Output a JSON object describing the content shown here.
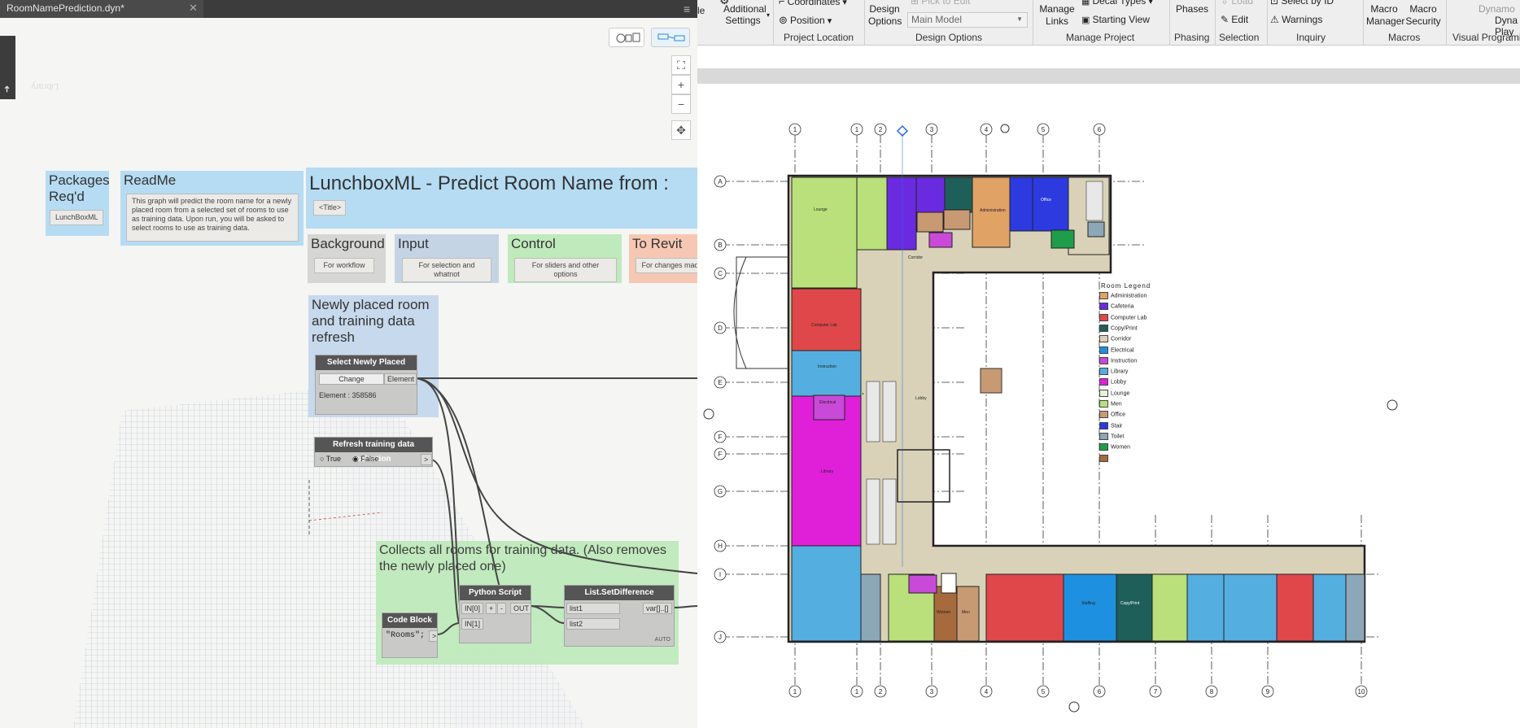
{
  "dynamo": {
    "tab_title": "RoomNamePrediction.dyn*",
    "library_label": "Library",
    "groups": {
      "packages": {
        "title": "Packages Req'd",
        "note": "LunchBoxML"
      },
      "readme": {
        "title": "ReadMe",
        "note": "This graph will predict the room name for a newly placed room from a selected set of rooms to use as training data. Upon run, you will be asked to select rooms to use as training data."
      },
      "main_title": {
        "title": "LunchboxML - Predict Room Name from :",
        "note": "<Title>"
      },
      "background": {
        "title": "Background",
        "note": "For workflow"
      },
      "input": {
        "title": "Input",
        "note": "For selection and whatnot"
      },
      "control": {
        "title": "Control",
        "note": "For sliders and other options"
      },
      "to_revit": {
        "title": "To Revit",
        "note": "For changes made"
      },
      "newly_placed": {
        "title": "Newly placed room and training data refresh"
      },
      "collects": {
        "title": "Collects all rooms for training data. (Also removes the newly placed one)"
      }
    },
    "nodes": {
      "select_room": {
        "title": "Select Newly Placed Room",
        "change": "Change",
        "out": "Element",
        "value": "Element : 358586"
      },
      "refresh": {
        "title": "Refresh training data selection",
        "true_label": "True",
        "false_label": "False",
        "out": ">"
      },
      "python": {
        "title": "Python Script",
        "in0": "IN[0]",
        "in1": "IN[1]",
        "plus": "+",
        "minus": "-",
        "out": "OUT"
      },
      "code_block": {
        "title": "Code Block",
        "code": "\"Rooms\";",
        "out": ">"
      },
      "setdiff": {
        "title": "List.SetDifference",
        "list1": "list1",
        "list2": "list2",
        "out": "var[]..[]",
        "auto": "AUTO"
      }
    }
  },
  "revit": {
    "ribbon": {
      "cut_label": "le",
      "additional_settings": "Additional Settings",
      "coordinates": "Coordinates",
      "position": "Position",
      "design_options_btn": "Design Options",
      "pick_to_edit": "Pick to Edit",
      "main_model": "Main Model",
      "manage_links": "Manage Links",
      "decal_types": "Decal Types",
      "starting_view": "Starting View",
      "phases": "Phases",
      "load": "Load",
      "edit": "Edit",
      "select_by_id": "Select  by ID",
      "warnings": "Warnings",
      "macro_manager": "Macro Manager",
      "macro_security": "Macro Security",
      "dynamo": "Dynamo",
      "dyna_player": "Dyna Play",
      "panels": {
        "project_location": "Project Location",
        "design_options": "Design Options",
        "manage_project": "Manage Project",
        "phasing": "Phasing",
        "selection": "Selection",
        "inquiry": "Inquiry",
        "macros": "Macros",
        "visual_programming": "Visual Programi"
      }
    },
    "grid_top": [
      "1",
      "1",
      "2",
      "3",
      "4",
      "5",
      "6"
    ],
    "grid_bottom": [
      "1",
      "1",
      "2",
      "3",
      "4",
      "5",
      "6",
      "7",
      "8",
      "9",
      "10"
    ],
    "grid_left": [
      "A",
      "B",
      "C",
      "D",
      "E",
      "F",
      "F",
      "G",
      "H",
      "I",
      "J"
    ],
    "legend": {
      "title": "Room Legend",
      "items": [
        {
          "label": "Administration",
          "color": "#e0a265"
        },
        {
          "label": "Cafeteria",
          "color": "#6a2be0"
        },
        {
          "label": "Computer Lab",
          "color": "#e0474a"
        },
        {
          "label": "Copy/Print",
          "color": "#1f5f5a"
        },
        {
          "label": "Corridor",
          "color": "#d9d2b8"
        },
        {
          "label": "Electrical",
          "color": "#1e90e0"
        },
        {
          "label": "Instruction",
          "color": "#c94ad9"
        },
        {
          "label": "Library",
          "color": "#55aee0"
        },
        {
          "label": "Lobby",
          "color": "#e01fd9"
        },
        {
          "label": "Lounge",
          "color": "#e8f0d8"
        },
        {
          "label": "Men",
          "color": "#b9e07a"
        },
        {
          "label": "Office",
          "color": "#c89a73"
        },
        {
          "label": "Stair",
          "color": "#2c3ae0"
        },
        {
          "label": "Toilet",
          "color": "#8ca7b8"
        },
        {
          "label": "Women",
          "color": "#1e9e4a"
        },
        {
          "label": "",
          "color": "#a66a3c"
        }
      ]
    },
    "room_labels": {
      "lounge": "Lounge",
      "corridor": "Corridor",
      "instruction": "Instruction",
      "computer_lab": "Computer Lab",
      "library": "Library",
      "administration": "Administration",
      "office": "Office",
      "lobby": "Lobby",
      "staffing": "Staffing",
      "copy_print": "Copy/Print",
      "women": "Women",
      "men": "Men",
      "electrical": "Electrical"
    }
  }
}
